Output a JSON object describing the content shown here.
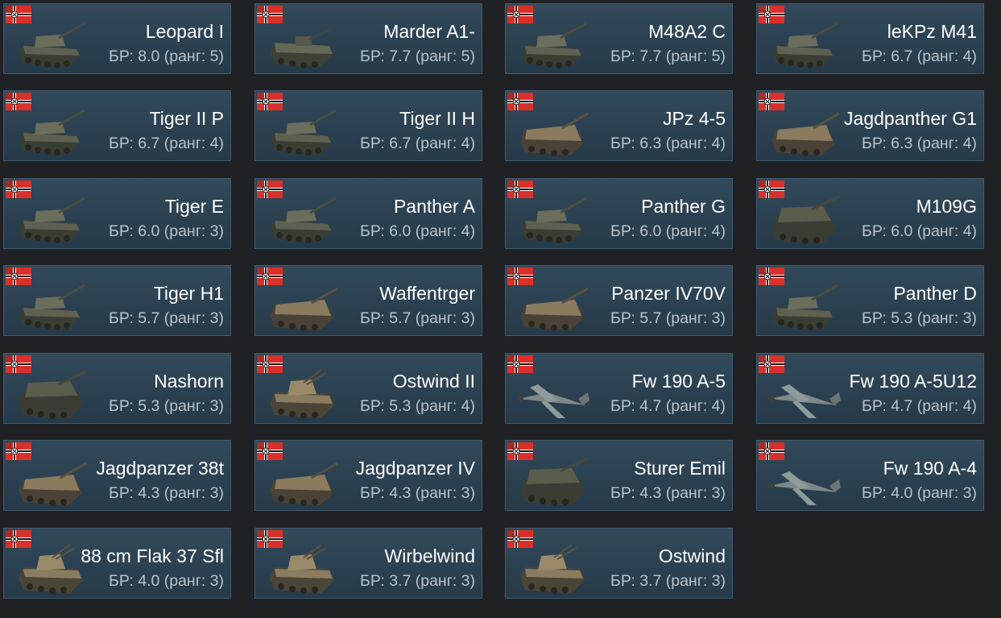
{
  "vehicles": [
    {
      "name": "Leopard I",
      "br": "БР: 8.0 (ранг: 5)",
      "kind": "tank"
    },
    {
      "name": "Marder A1-",
      "br": "БР: 7.7 (ранг: 5)",
      "kind": "ifv"
    },
    {
      "name": "M48A2 C",
      "br": "БР: 7.7 (ранг: 5)",
      "kind": "tank"
    },
    {
      "name": "leKPz M41",
      "br": "БР: 6.7 (ранг: 4)",
      "kind": "tank"
    },
    {
      "name": "Tiger II P",
      "br": "БР: 6.7 (ранг: 4)",
      "kind": "tank"
    },
    {
      "name": "Tiger II H",
      "br": "БР: 6.7 (ранг: 4)",
      "kind": "tank"
    },
    {
      "name": "JPz 4-5",
      "br": "БР: 6.3 (ранг: 4)",
      "kind": "td"
    },
    {
      "name": "Jagdpanther G1",
      "br": "БР: 6.3 (ранг: 4)",
      "kind": "td"
    },
    {
      "name": "Tiger E",
      "br": "БР: 6.0 (ранг: 3)",
      "kind": "tank"
    },
    {
      "name": "Panther A",
      "br": "БР: 6.0 (ранг: 4)",
      "kind": "tank"
    },
    {
      "name": "Panther G",
      "br": "БР: 6.0 (ранг: 4)",
      "kind": "tank"
    },
    {
      "name": "M109G",
      "br": "БР: 6.0 (ранг: 4)",
      "kind": "spg"
    },
    {
      "name": "Tiger H1",
      "br": "БР: 5.7 (ранг: 3)",
      "kind": "tank"
    },
    {
      "name": "Waffentrger",
      "br": "БР: 5.7 (ранг: 3)",
      "kind": "td"
    },
    {
      "name": "Panzer IV70V",
      "br": "БР: 5.7 (ранг: 3)",
      "kind": "td"
    },
    {
      "name": "Panther D",
      "br": "БР: 5.3 (ранг: 3)",
      "kind": "tank"
    },
    {
      "name": "Nashorn",
      "br": "БР: 5.3 (ранг: 3)",
      "kind": "spg"
    },
    {
      "name": "Ostwind II",
      "br": "БР: 5.3 (ранг: 4)",
      "kind": "spaa"
    },
    {
      "name": "Fw 190 A-5",
      "br": "БР: 4.7 (ранг: 4)",
      "kind": "plane"
    },
    {
      "name": "Fw 190 A-5U12",
      "br": "БР: 4.7 (ранг: 4)",
      "kind": "plane"
    },
    {
      "name": "Jagdpanzer 38t",
      "br": "БР: 4.3 (ранг: 3)",
      "kind": "td"
    },
    {
      "name": "Jagdpanzer IV",
      "br": "БР: 4.3 (ранг: 3)",
      "kind": "td"
    },
    {
      "name": "Sturer Emil",
      "br": "БР: 4.3 (ранг: 3)",
      "kind": "spg"
    },
    {
      "name": "Fw 190 A-4",
      "br": "БР: 4.0 (ранг: 3)",
      "kind": "plane"
    },
    {
      "name": "88 cm Flak 37 Sfl",
      "br": "БР: 4.0 (ранг: 3)",
      "kind": "spaa"
    },
    {
      "name": "Wirbelwind",
      "br": "БР: 3.7 (ранг: 3)",
      "kind": "spaa"
    },
    {
      "name": "Ostwind",
      "br": "БР: 3.7 (ранг: 3)",
      "kind": "spaa"
    }
  ],
  "icons": {
    "flag": "germany-war-flag-icon",
    "tank": "tank-icon",
    "ifv": "ifv-icon",
    "td": "tank-destroyer-icon",
    "spg": "self-propelled-gun-icon",
    "spaa": "anti-aircraft-vehicle-icon",
    "plane": "plane-icon"
  },
  "colors": {
    "background": "#202124",
    "card": "#2d4353",
    "card_border": "#3f5a6c",
    "name_text": "#ffffff",
    "br_text": "#b9c3cc",
    "flag_red": "#d8312b",
    "flag_black": "#111111"
  }
}
